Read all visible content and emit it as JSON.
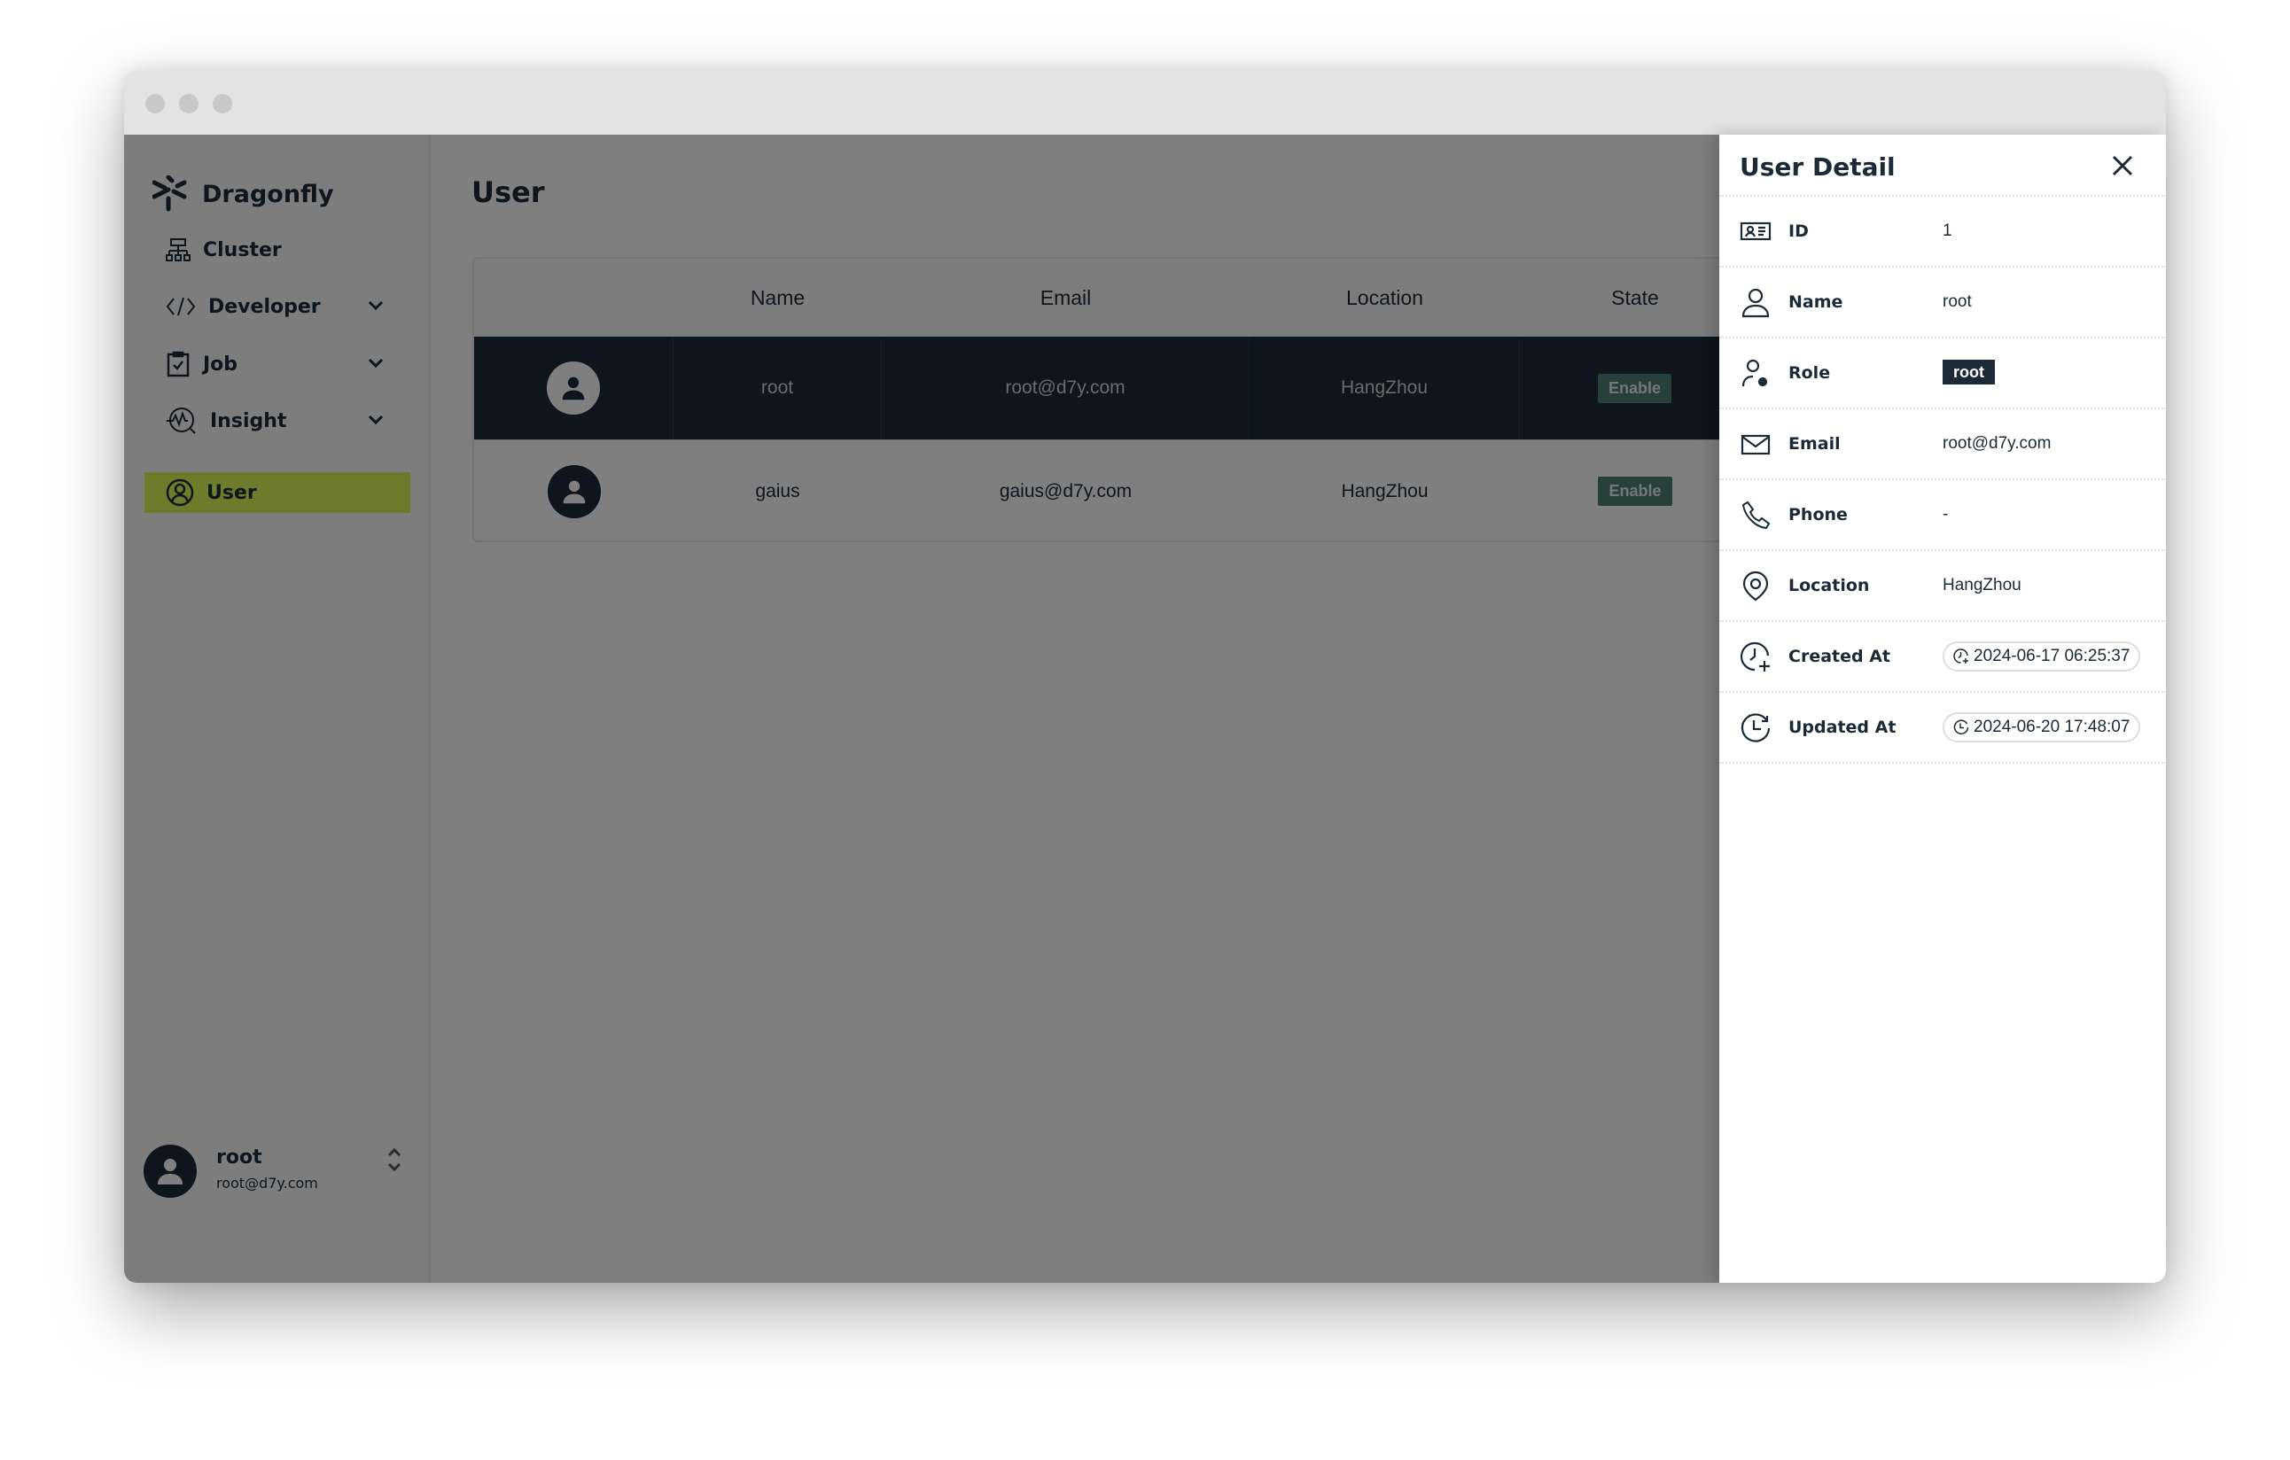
{
  "brand": {
    "name": "Dragonfly"
  },
  "sidebar": {
    "items": [
      {
        "label": "Cluster",
        "icon": "cluster-icon"
      },
      {
        "label": "Developer",
        "icon": "code-icon",
        "expandable": true
      },
      {
        "label": "Job",
        "icon": "clipboard-check-icon",
        "expandable": true
      },
      {
        "label": "Insight",
        "icon": "insight-icon",
        "expandable": true
      },
      {
        "label": "User",
        "icon": "user-circle-icon",
        "selected": true
      }
    ],
    "account": {
      "name": "root",
      "email": "root@d7y.com"
    }
  },
  "main": {
    "title": "User",
    "table": {
      "columns": [
        "",
        "Name",
        "Email",
        "Location",
        "State"
      ],
      "rows": [
        {
          "name": "root",
          "email": "root@d7y.com",
          "location": "HangZhou",
          "state": "Enable",
          "selected": true
        },
        {
          "name": "gaius",
          "email": "gaius@d7y.com",
          "location": "HangZhou",
          "state": "Enable"
        }
      ]
    }
  },
  "drawer": {
    "title": "User Detail",
    "fields": [
      {
        "label": "ID",
        "value": "1"
      },
      {
        "label": "Name",
        "value": "root"
      },
      {
        "label": "Role",
        "value": "root"
      },
      {
        "label": "Email",
        "value": "root@d7y.com"
      },
      {
        "label": "Phone",
        "value": "-"
      },
      {
        "label": "Location",
        "value": "HangZhou"
      },
      {
        "label": "Created At",
        "value": "2024-06-17 06:25:37"
      },
      {
        "label": "Updated At",
        "value": "2024-06-20 17:48:07"
      }
    ]
  },
  "colors": {
    "accent": "#dcf654",
    "dark": "#1c2a38",
    "state_chip": "#4f8075"
  }
}
